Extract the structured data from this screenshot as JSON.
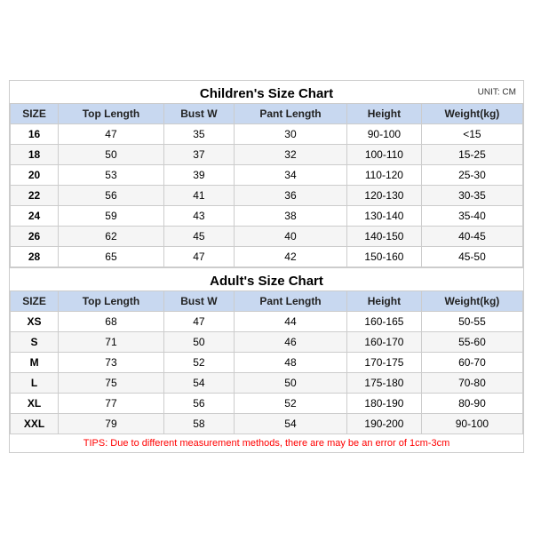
{
  "children": {
    "title": "Children's Size Chart",
    "unit": "UNIT: CM",
    "columns": [
      "SIZE",
      "Top Length",
      "Bust W",
      "Pant Length",
      "Height",
      "Weight(kg)"
    ],
    "rows": [
      [
        "16",
        "47",
        "35",
        "30",
        "90-100",
        "<15"
      ],
      [
        "18",
        "50",
        "37",
        "32",
        "100-110",
        "15-25"
      ],
      [
        "20",
        "53",
        "39",
        "34",
        "110-120",
        "25-30"
      ],
      [
        "22",
        "56",
        "41",
        "36",
        "120-130",
        "30-35"
      ],
      [
        "24",
        "59",
        "43",
        "38",
        "130-140",
        "35-40"
      ],
      [
        "26",
        "62",
        "45",
        "40",
        "140-150",
        "40-45"
      ],
      [
        "28",
        "65",
        "47",
        "42",
        "150-160",
        "45-50"
      ]
    ]
  },
  "adults": {
    "title": "Adult's Size Chart",
    "columns": [
      "SIZE",
      "Top Length",
      "Bust W",
      "Pant Length",
      "Height",
      "Weight(kg)"
    ],
    "rows": [
      [
        "XS",
        "68",
        "47",
        "44",
        "160-165",
        "50-55"
      ],
      [
        "S",
        "71",
        "50",
        "46",
        "160-170",
        "55-60"
      ],
      [
        "M",
        "73",
        "52",
        "48",
        "170-175",
        "60-70"
      ],
      [
        "L",
        "75",
        "54",
        "50",
        "175-180",
        "70-80"
      ],
      [
        "XL",
        "77",
        "56",
        "52",
        "180-190",
        "80-90"
      ],
      [
        "XXL",
        "79",
        "58",
        "54",
        "190-200",
        "90-100"
      ]
    ]
  },
  "tips": "TIPS: Due to different measurement methods, there are may be an error of 1cm-3cm"
}
